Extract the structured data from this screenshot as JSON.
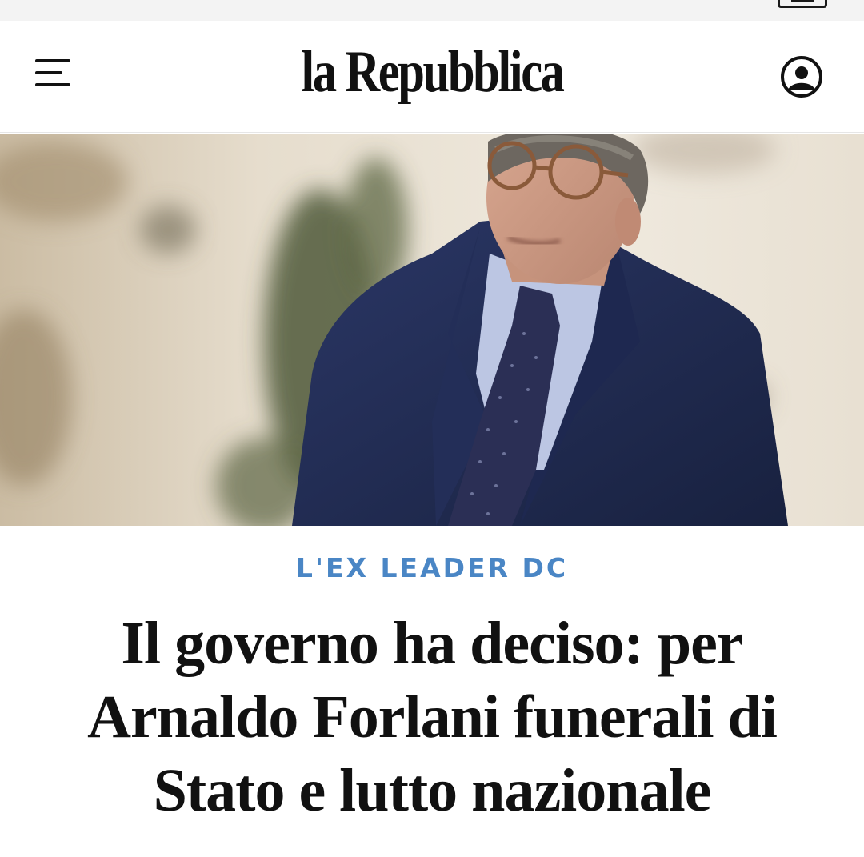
{
  "app": {
    "brand": "la Repubblica"
  },
  "icons": {
    "menu": "hamburger-menu-icon",
    "profile": "user-profile-icon"
  },
  "hero": {
    "image_subject": "elderly-man-in-suit-photo"
  },
  "article": {
    "kicker": "L'EX LEADER DC",
    "title": "Il governo ha deciso: per Arnaldo Forlani funerali di Stato e lutto nazionale"
  },
  "colors": {
    "kicker": "#4a86c5",
    "text": "#111111",
    "background": "#ffffff"
  }
}
